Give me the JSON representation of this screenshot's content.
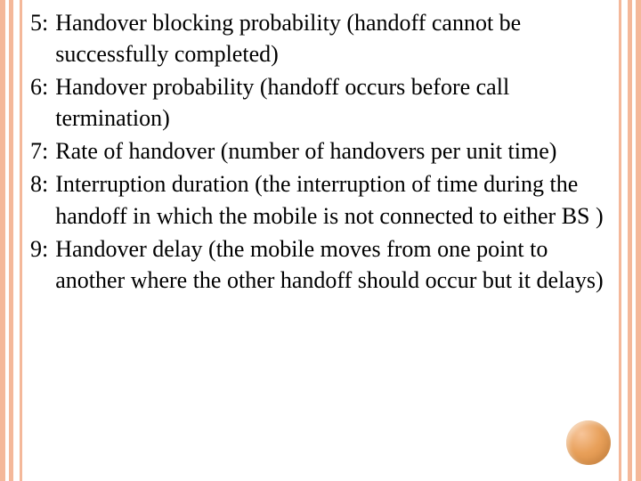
{
  "items": [
    {
      "num": "5:",
      "text": "Handover blocking probability (handoff cannot be successfully completed)"
    },
    {
      "num": "6:",
      "text": "Handover probability (handoff occurs before call termination)"
    },
    {
      "num": "7:",
      "text": "Rate of handover (number of handovers per unit time)"
    },
    {
      "num": "8:",
      "text": "Interruption duration (the interruption of time during the handoff in which the mobile is not connected to either BS )"
    },
    {
      "num": "9:",
      "text": "Handover delay (the mobile moves from one point to another where the other handoff should occur but it delays)"
    }
  ]
}
